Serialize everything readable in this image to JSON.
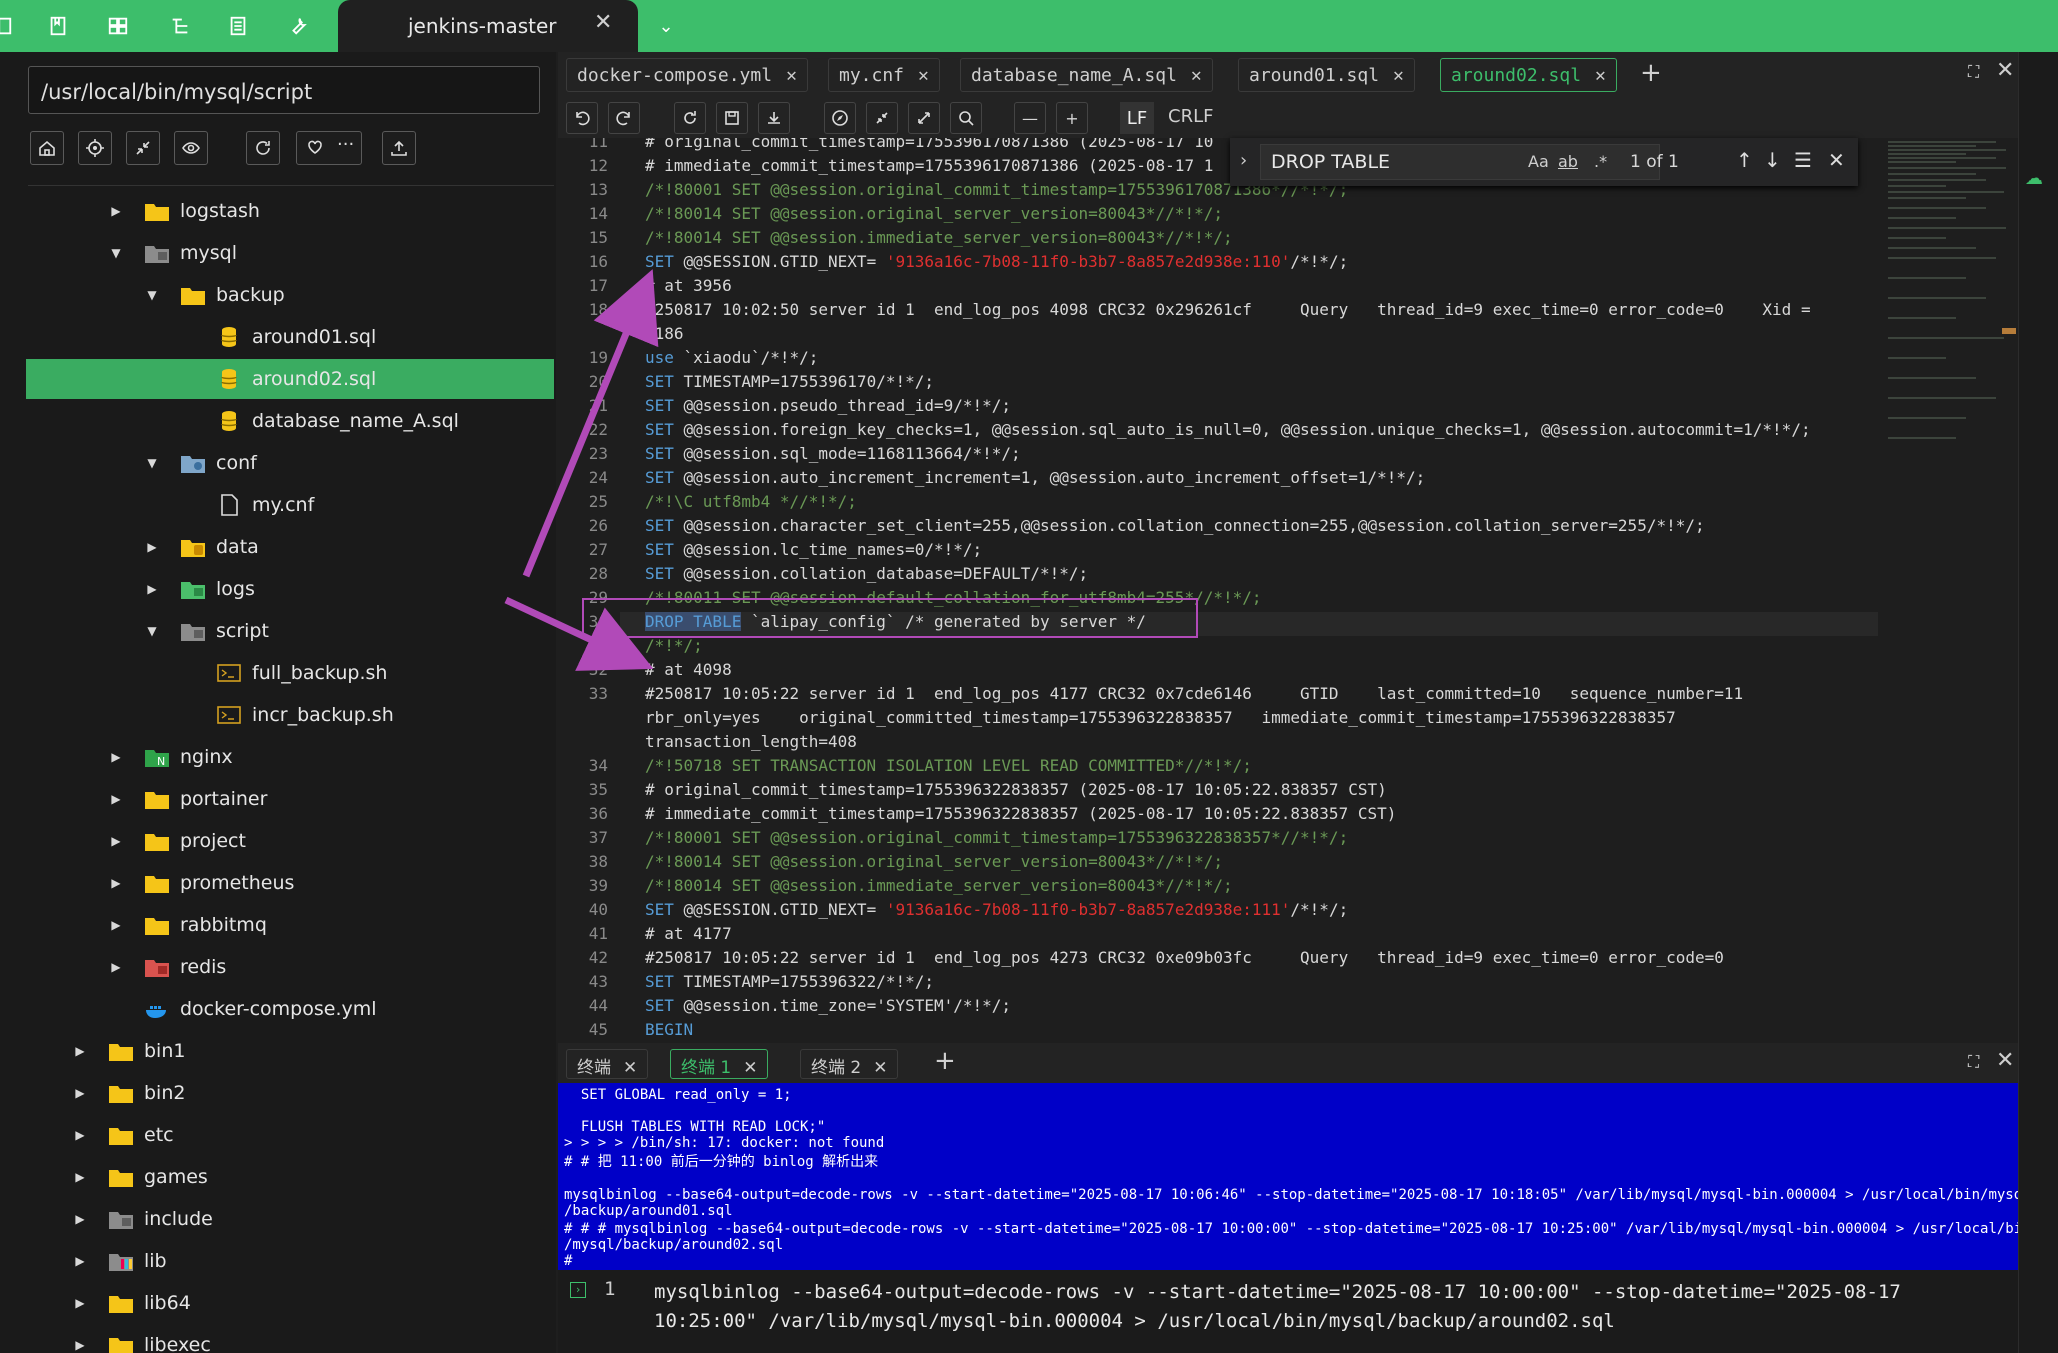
{
  "topbar": {
    "active_tab": "jenkins-master",
    "icons": [
      "bookmark-icon",
      "grid-icon",
      "tree-icon",
      "list-icon",
      "wrench-icon"
    ]
  },
  "sidebar": {
    "path": "/usr/local/bin/mysql/script",
    "tree": [
      {
        "label": "logstash",
        "icon": "folder",
        "depth": 3,
        "arrow": "right"
      },
      {
        "label": "mysql",
        "icon": "folder-gray",
        "depth": 3,
        "arrow": "down"
      },
      {
        "label": "backup",
        "icon": "folder",
        "depth": 4,
        "arrow": "down"
      },
      {
        "label": "around01.sql",
        "icon": "db",
        "depth": 5,
        "arrow": ""
      },
      {
        "label": "around02.sql",
        "icon": "db",
        "depth": 5,
        "arrow": "",
        "selected": true
      },
      {
        "label": "database_name_A.sql",
        "icon": "db",
        "depth": 5,
        "arrow": ""
      },
      {
        "label": "conf",
        "icon": "folder-blue",
        "depth": 4,
        "arrow": "down"
      },
      {
        "label": "my.cnf",
        "icon": "file",
        "depth": 5,
        "arrow": ""
      },
      {
        "label": "data",
        "icon": "folder-db",
        "depth": 4,
        "arrow": "right"
      },
      {
        "label": "logs",
        "icon": "folder-green",
        "depth": 4,
        "arrow": "right"
      },
      {
        "label": "script",
        "icon": "folder-gray",
        "depth": 4,
        "arrow": "down"
      },
      {
        "label": "full_backup.sh",
        "icon": "shell",
        "depth": 5,
        "arrow": ""
      },
      {
        "label": "incr_backup.sh",
        "icon": "shell",
        "depth": 5,
        "arrow": ""
      },
      {
        "label": "nginx",
        "icon": "folder-nginx",
        "depth": 3,
        "arrow": "right"
      },
      {
        "label": "portainer",
        "icon": "folder",
        "depth": 3,
        "arrow": "right"
      },
      {
        "label": "project",
        "icon": "folder",
        "depth": 3,
        "arrow": "right"
      },
      {
        "label": "prometheus",
        "icon": "folder",
        "depth": 3,
        "arrow": "right"
      },
      {
        "label": "rabbitmq",
        "icon": "folder",
        "depth": 3,
        "arrow": "right"
      },
      {
        "label": "redis",
        "icon": "folder-red",
        "depth": 3,
        "arrow": "right"
      },
      {
        "label": "docker-compose.yml",
        "icon": "docker",
        "depth": 3,
        "arrow": ""
      },
      {
        "label": "bin1",
        "icon": "folder",
        "depth": 2,
        "arrow": "right"
      },
      {
        "label": "bin2",
        "icon": "folder",
        "depth": 2,
        "arrow": "right"
      },
      {
        "label": "etc",
        "icon": "folder",
        "depth": 2,
        "arrow": "right"
      },
      {
        "label": "games",
        "icon": "folder",
        "depth": 2,
        "arrow": "right"
      },
      {
        "label": "include",
        "icon": "folder-gray",
        "depth": 2,
        "arrow": "right"
      },
      {
        "label": "lib",
        "icon": "folder-multi",
        "depth": 2,
        "arrow": "right"
      },
      {
        "label": "lib64",
        "icon": "folder",
        "depth": 2,
        "arrow": "right"
      },
      {
        "label": "libexec",
        "icon": "folder",
        "depth": 2,
        "arrow": "right"
      }
    ]
  },
  "editor": {
    "tabs": [
      {
        "label": "docker-compose.yml",
        "active": false
      },
      {
        "label": "my.cnf",
        "active": false
      },
      {
        "label": "database_name_A.sql",
        "active": false
      },
      {
        "label": "around01.sql",
        "active": false
      },
      {
        "label": "around02.sql",
        "active": true
      }
    ],
    "lf": "LF",
    "crlf": "CRLF",
    "find": {
      "query": "DROP TABLE",
      "match_case": "Aa",
      "whole_word": "ab",
      "regex": ".*",
      "count": "1 of 1"
    },
    "lines": [
      {
        "n": "11",
        "t": "# original_commit_timestamp=1755396170871386 (2025-08-17 10",
        "c": "plain"
      },
      {
        "n": "12",
        "t": "# immediate_commit_timestamp=1755396170871386 (2025-08-17 1",
        "c": "plain"
      },
      {
        "n": "13",
        "t": "/*!80001 SET @@session.original_commit_timestamp=1755396170871386*//*!*/;",
        "c": "cmt"
      },
      {
        "n": "14",
        "t": "/*!80014 SET @@session.original_server_version=80043*//*!*/;",
        "c": "cmt"
      },
      {
        "n": "15",
        "t": "/*!80014 SET @@session.immediate_server_version=80043*//*!*/;",
        "c": "cmt"
      },
      {
        "n": "16",
        "t": "SET @@SESSION.GTID_NEXT= '9136a16c-7b08-11f0-b3b7-8a857e2d938e:110'/*!*/;",
        "c": "plain"
      },
      {
        "n": "17",
        "t": "# at 3956",
        "c": "plain"
      },
      {
        "n": "18",
        "t": "#250817 10:02:50 server id 1  end_log_pos 4098 CRC32 0x296261cf     Query   thread_id=9 exec_time=0 error_code=0    Xid =",
        "c": "plain"
      },
      {
        "n": "",
        "t": "1186",
        "c": "plain"
      },
      {
        "n": "19",
        "t": "use `xiaodu`/*!*/;",
        "c": "plain"
      },
      {
        "n": "20",
        "t": "SET TIMESTAMP=1755396170/*!*/;",
        "c": "plain"
      },
      {
        "n": "21",
        "t": "SET @@session.pseudo_thread_id=9/*!*/;",
        "c": "plain"
      },
      {
        "n": "22",
        "t": "SET @@session.foreign_key_checks=1, @@session.sql_auto_is_null=0, @@session.unique_checks=1, @@session.autocommit=1/*!*/;",
        "c": "plain"
      },
      {
        "n": "23",
        "t": "SET @@session.sql_mode=1168113664/*!*/;",
        "c": "plain"
      },
      {
        "n": "24",
        "t": "SET @@session.auto_increment_increment=1, @@session.auto_increment_offset=1/*!*/;",
        "c": "plain"
      },
      {
        "n": "25",
        "t": "/*!\\C utf8mb4 *//*!*/;",
        "c": "cmt"
      },
      {
        "n": "26",
        "t": "SET @@session.character_set_client=255,@@session.collation_connection=255,@@session.collation_server=255/*!*/;",
        "c": "plain"
      },
      {
        "n": "27",
        "t": "SET @@session.lc_time_names=0/*!*/;",
        "c": "plain"
      },
      {
        "n": "28",
        "t": "SET @@session.collation_database=DEFAULT/*!*/;",
        "c": "plain"
      },
      {
        "n": "29",
        "t": "/*!80011 SET @@session.default_collation_for_utf8mb4=255*//*!*/;",
        "c": "cmt"
      },
      {
        "n": "30",
        "t": "DROP TABLE `alipay_config` /* generated by server */",
        "c": "plain"
      },
      {
        "n": "31",
        "t": "/*!*/;",
        "c": "cmt"
      },
      {
        "n": "32",
        "t": "# at 4098",
        "c": "plain"
      },
      {
        "n": "33",
        "t": "#250817 10:05:22 server id 1  end_log_pos 4177 CRC32 0x7cde6146     GTID    last_committed=10   sequence_number=11",
        "c": "plain"
      },
      {
        "n": "",
        "t": "rbr_only=yes    original_committed_timestamp=1755396322838357   immediate_commit_timestamp=1755396322838357",
        "c": "plain"
      },
      {
        "n": "",
        "t": "transaction_length=408",
        "c": "plain"
      },
      {
        "n": "34",
        "t": "/*!50718 SET TRANSACTION ISOLATION LEVEL READ COMMITTED*//*!*/;",
        "c": "cmt"
      },
      {
        "n": "35",
        "t": "# original_commit_timestamp=1755396322838357 (2025-08-17 10:05:22.838357 CST)",
        "c": "plain"
      },
      {
        "n": "36",
        "t": "# immediate_commit_timestamp=1755396322838357 (2025-08-17 10:05:22.838357 CST)",
        "c": "plain"
      },
      {
        "n": "37",
        "t": "/*!80001 SET @@session.original_commit_timestamp=1755396322838357*//*!*/;",
        "c": "cmt"
      },
      {
        "n": "38",
        "t": "/*!80014 SET @@session.original_server_version=80043*//*!*/;",
        "c": "cmt"
      },
      {
        "n": "39",
        "t": "/*!80014 SET @@session.immediate_server_version=80043*//*!*/;",
        "c": "cmt"
      },
      {
        "n": "40",
        "t": "SET @@SESSION.GTID_NEXT= '9136a16c-7b08-11f0-b3b7-8a857e2d938e:111'/*!*/;",
        "c": "plain"
      },
      {
        "n": "41",
        "t": "# at 4177",
        "c": "plain"
      },
      {
        "n": "42",
        "t": "#250817 10:05:22 server id 1  end_log_pos 4273 CRC32 0xe09b03fc     Query   thread_id=9 exec_time=0 error_code=0",
        "c": "plain"
      },
      {
        "n": "43",
        "t": "SET TIMESTAMP=1755396322/*!*/;",
        "c": "plain"
      },
      {
        "n": "44",
        "t": "SET @@session.time_zone='SYSTEM'/*!*/;",
        "c": "plain"
      },
      {
        "n": "45",
        "t": "BEGIN",
        "c": "kw"
      }
    ]
  },
  "terminal": {
    "tabs": [
      {
        "label": "终端",
        "active": false
      },
      {
        "label": "终端 1",
        "active": true
      },
      {
        "label": "终端 2",
        "active": false
      }
    ],
    "output": [
      "  SET GLOBAL read_only = 1;",
      "",
      "  FLUSH TABLES WITH READ LOCK;\"",
      "> > > > /bin/sh: 17: docker: not found",
      "# # 把 11:00 前后一分钟的 binlog 解析出来",
      "",
      "mysqlbinlog --base64-output=decode-rows -v --start-datetime=\"2025-08-17 10:06:46\" --stop-datetime=\"2025-08-17 10:18:05\" /var/lib/mysql/mysql-bin.000004 > /usr/local/bin/mysql",
      "/backup/around01.sql",
      "# # # mysqlbinlog --base64-output=decode-rows -v --start-datetime=\"2025-08-17 10:00:00\" --stop-datetime=\"2025-08-17 10:25:00\" /var/lib/mysql/mysql-bin.000004 > /usr/local/bin",
      "/mysql/backup/around02.sql",
      "#"
    ],
    "input_line_no": "1",
    "input": "mysqlbinlog --base64-output=decode-rows -v --start-datetime=\"2025-08-17 10:00:00\" --stop-datetime=\"2025-08-17 10:25:00\" /var/lib/mysql/mysql-bin.000004 > /usr/local/bin/mysql/backup/around02.sql"
  },
  "colors": {
    "accent": "#3dbe6b",
    "annotation": "#b14ab8",
    "terminal_bg": "#0000c8"
  }
}
